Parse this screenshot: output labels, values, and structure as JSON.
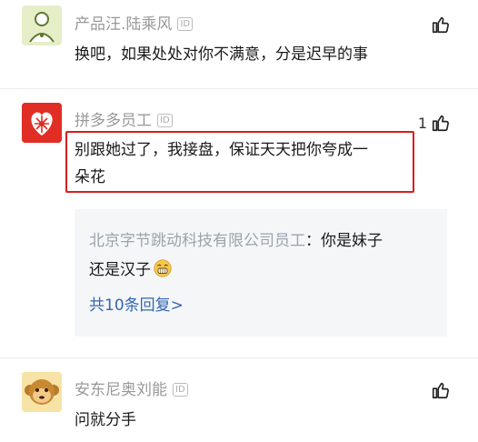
{
  "comments": [
    {
      "username": "产品汪.陆乘风",
      "badge": "ID",
      "text": "换吧，如果处处对你不满意，分是迟早的事",
      "likes": ""
    },
    {
      "username": "拼多多员工",
      "badge": "ID",
      "text_line1": "别跟她过了，我接盘，保证天天把你夸成一",
      "text_line2": "朵花",
      "likes": "1",
      "reply": {
        "author": "北京字节跳动科技有限公司员工",
        "colon": "：",
        "text_line1": "你是妹子",
        "text_line2": "还是汉子",
        "more_label": "共10条回复>"
      }
    },
    {
      "username": "安东尼奥刘能",
      "badge": "ID",
      "text": "问就分手",
      "likes": ""
    }
  ],
  "colors": {
    "highlight_border": "#d81e1e",
    "link": "#3466b2",
    "muted_name": "#999999",
    "reply_bg": "#f5f6f8"
  },
  "icons": [
    "avatar-default-icon",
    "pinduoduo-logo-icon",
    "monkey-avatar-icon",
    "thumbs-up-icon",
    "laughing-emoji-icon"
  ]
}
